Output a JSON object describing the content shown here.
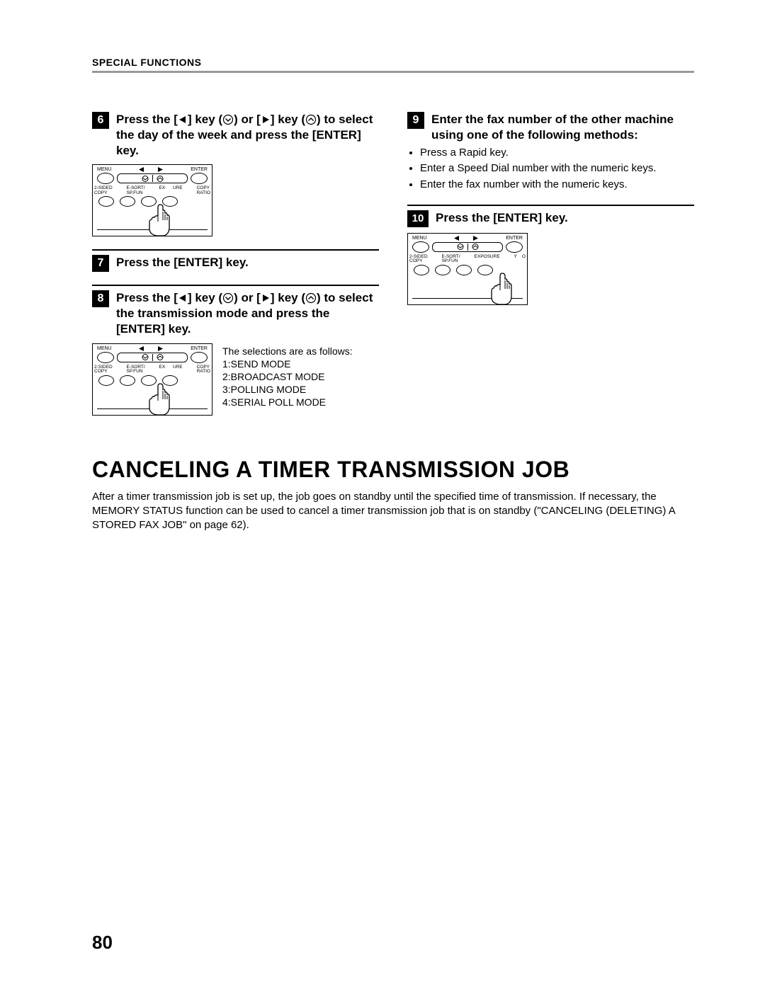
{
  "header": "SPECIAL FUNCTIONS",
  "panelLabels": {
    "menu": "MENU",
    "enter": "ENTER",
    "row2_a": "2-SIDED\nCOPY",
    "row2_b": "E-SORT/\nSP.FUN",
    "row2_c_left": "EX",
    "row2_c_left2": "EXPOSURE",
    "row2_c_right": "URE",
    "row2_d": "COPY\nRATIO",
    "row2_d2_left": "Y",
    "row2_d2_right": "O"
  },
  "leftSteps": [
    {
      "num": "6",
      "title_parts": {
        "a": "Press the [",
        "b": "] key (",
        "c": ") or [",
        "d": "] key (",
        "e": ") to select the day of the week and press the [ENTER] key."
      },
      "showPanel": true,
      "handTarget": "center"
    },
    {
      "num": "7",
      "title_plain": "Press the [ENTER] key."
    },
    {
      "num": "8",
      "title_parts": {
        "a": "Press the [",
        "b": "] key (",
        "c": ") or [",
        "d": "] key (",
        "e": ") to select the transmission mode and press the [ENTER] key."
      },
      "showPanel": true,
      "handTarget": "center",
      "sideCaption": "The selections are as follows:\n1:SEND MODE\n2:BROADCAST MODE\n3:POLLING MODE\n4:SERIAL POLL MODE"
    }
  ],
  "rightSteps": [
    {
      "num": "9",
      "title_plain": "Enter the fax number of the other machine using one of the following methods:",
      "bullets": [
        "Press a Rapid key.",
        "Enter a Speed Dial number with the numeric keys.",
        "Enter the fax number with the numeric keys."
      ]
    },
    {
      "num": "10",
      "wideNum": true,
      "title_plain": "Press the [ENTER] key.",
      "showPanel": true,
      "handTarget": "right"
    }
  ],
  "bigHeading": "CANCELING A TIMER TRANSMISSION JOB",
  "paragraph": "After a timer transmission job is set up, the job goes on standby until the specified time of transmission. If necessary, the MEMORY STATUS function can be used to cancel a timer transmission job that is on standby (\"CANCELING (DELETING) A STORED FAX JOB\" on page 62).",
  "pageNumber": "80"
}
